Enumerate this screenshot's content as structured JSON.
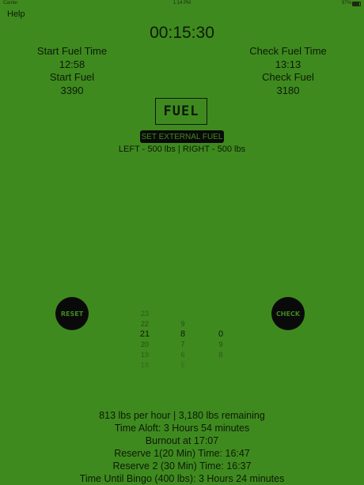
{
  "status_bar": {
    "carrier": "Carrier",
    "time": "1:14 PM",
    "battery": "97%"
  },
  "help_label": "Help",
  "timer": "00:15:30",
  "start_fuel": {
    "time_label": "Start Fuel Time",
    "time_value": "12:58",
    "fuel_label": "Start Fuel",
    "fuel_value": "3390"
  },
  "check_fuel": {
    "time_label": "Check Fuel Time",
    "time_value": "13:13",
    "fuel_label": "Check Fuel",
    "fuel_value": "3180"
  },
  "logo_text": "FUEL",
  "external_fuel": {
    "button_label": "SET EXTERNAL FUEL",
    "info": "LEFT - 500 lbs | RIGHT - 500 lbs"
  },
  "reset_label": "RESET",
  "check_label": "CHECK",
  "picker": {
    "columns": [
      [
        "23",
        "22",
        "21",
        "20",
        "19",
        "18"
      ],
      [
        "",
        "9",
        "8",
        "7",
        "6",
        "5"
      ],
      [
        "",
        "",
        "0",
        "9",
        "8",
        ""
      ]
    ],
    "selected_index": 2
  },
  "summary": [
    "813 lbs per hour | 3,180 lbs remaining",
    "Time Aloft: 3 Hours 54 minutes",
    "Burnout at 17:07",
    "Reserve 1(20 Min) Time: 16:47",
    "Reserve 2 (30 Min) Time: 16:37",
    "Time Until Bingo (400 lbs): 3 Hours 24 minutes"
  ]
}
